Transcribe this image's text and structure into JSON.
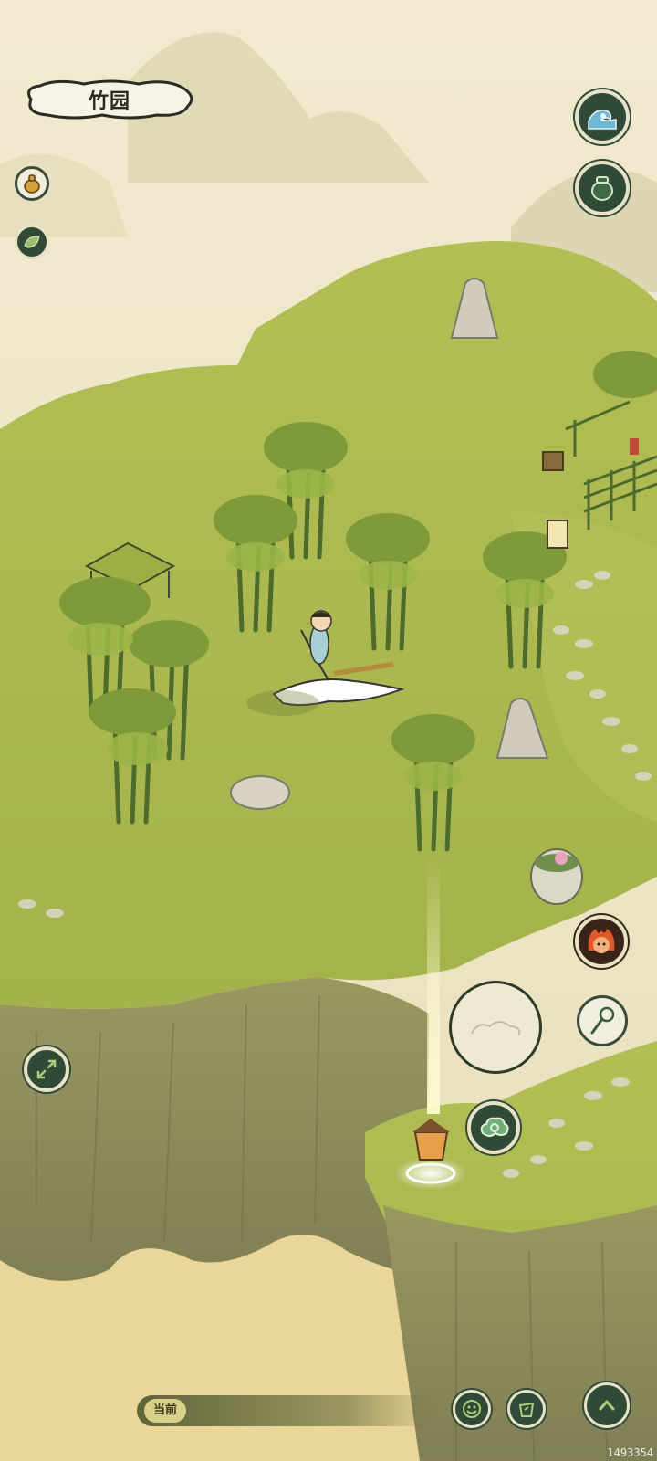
{
  "location": {
    "name": "竹园"
  },
  "chat": {
    "label": "当前"
  },
  "footer": {
    "build_id": "1493354"
  },
  "left_quick_icons": [
    "gourd-pouch-icon",
    "leaf-icon"
  ],
  "right_top_buttons": [
    "wave-icon",
    "jar-icon"
  ],
  "right_action_buttons": [
    "fire-spirit-portrait-icon",
    "net-staff-icon",
    "cloud-jump-icon"
  ],
  "bottom_bar_buttons": [
    "emote-face-icon",
    "item-bag-icon",
    "expand-up-icon"
  ],
  "left_side_buttons": [
    "resize-arrows-icon"
  ],
  "colors": {
    "grass": "#a9b84a",
    "cliff": "#8a8a5a",
    "sky": "#efe6c8",
    "button_dark": "#2f4a36"
  }
}
